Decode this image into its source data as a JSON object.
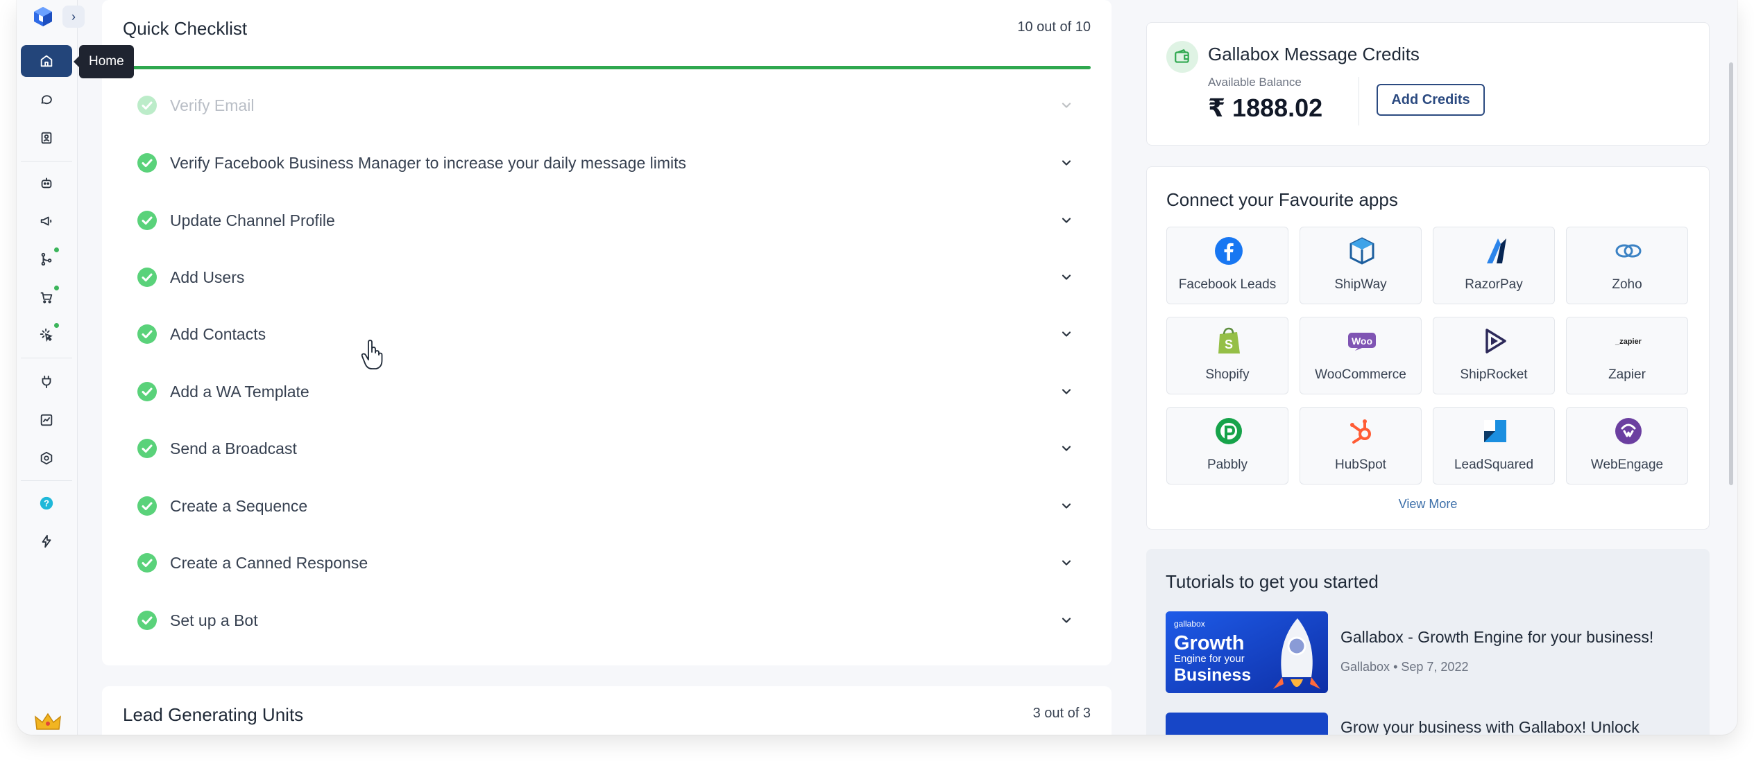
{
  "sidebar": {
    "tooltip": "Home",
    "items": [
      {
        "name": "home-icon"
      },
      {
        "name": "chat-icon"
      },
      {
        "name": "contacts-icon"
      },
      {
        "name": "bot-icon"
      },
      {
        "name": "broadcast-icon"
      },
      {
        "name": "flow-icon",
        "badge": true
      },
      {
        "name": "cart-icon",
        "badge": true
      },
      {
        "name": "click-icon",
        "badge": true
      },
      {
        "name": "plug-icon"
      },
      {
        "name": "analytics-icon"
      },
      {
        "name": "settings-icon"
      },
      {
        "name": "help-icon"
      },
      {
        "name": "bolt-icon"
      }
    ]
  },
  "checklist": {
    "title": "Quick Checklist",
    "count": "10 out of 10",
    "progress": 1.0,
    "items": [
      {
        "label": "Verify Email",
        "done": true
      },
      {
        "label": "Verify Facebook Business Manager to increase your daily message limits",
        "done": true
      },
      {
        "label": "Update Channel Profile",
        "done": true
      },
      {
        "label": "Add Users",
        "done": true
      },
      {
        "label": "Add Contacts",
        "done": true
      },
      {
        "label": "Add a WA Template",
        "done": true
      },
      {
        "label": "Send a Broadcast",
        "done": true
      },
      {
        "label": "Create a Sequence",
        "done": true
      },
      {
        "label": "Create a Canned Response",
        "done": true
      },
      {
        "label": "Set up a Bot",
        "done": true
      }
    ]
  },
  "lead_units": {
    "title": "Lead Generating Units",
    "count": "3 out of 3"
  },
  "credits": {
    "title": "Gallabox Message Credits",
    "balance_label": "Available Balance",
    "balance": "₹ 1888.02",
    "add_button": "Add Credits"
  },
  "apps": {
    "title": "Connect your Favourite apps",
    "view_more": "View More",
    "items": [
      {
        "label": "Facebook Leads",
        "icon": "facebook-icon"
      },
      {
        "label": "ShipWay",
        "icon": "shipway-icon"
      },
      {
        "label": "RazorPay",
        "icon": "razorpay-icon"
      },
      {
        "label": "Zoho",
        "icon": "zoho-icon"
      },
      {
        "label": "Shopify",
        "icon": "shopify-icon"
      },
      {
        "label": "WooCommerce",
        "icon": "woocommerce-icon"
      },
      {
        "label": "ShipRocket",
        "icon": "shiprocket-icon"
      },
      {
        "label": "Zapier",
        "icon": "zapier-icon"
      },
      {
        "label": "Pabbly",
        "icon": "pabbly-icon"
      },
      {
        "label": "HubSpot",
        "icon": "hubspot-icon"
      },
      {
        "label": "LeadSquared",
        "icon": "leadsquared-icon"
      },
      {
        "label": "WebEngage",
        "icon": "webengage-icon"
      }
    ]
  },
  "tutorials": {
    "title": "Tutorials to get you started",
    "items": [
      {
        "title": "Gallabox - Growth Engine for your business!",
        "author": "Gallabox",
        "date": "Sep 7, 2022",
        "thumb_brand": "gallabox",
        "thumb_line1": "Growth",
        "thumb_line2": "Engine for your",
        "thumb_line3": "Business"
      },
      {
        "title": "Grow your business with Gallabox! Unlock"
      }
    ]
  },
  "colors": {
    "accent_navy": "#23457a",
    "success_green": "#2fa84f",
    "link_blue": "#3b6ea8"
  }
}
